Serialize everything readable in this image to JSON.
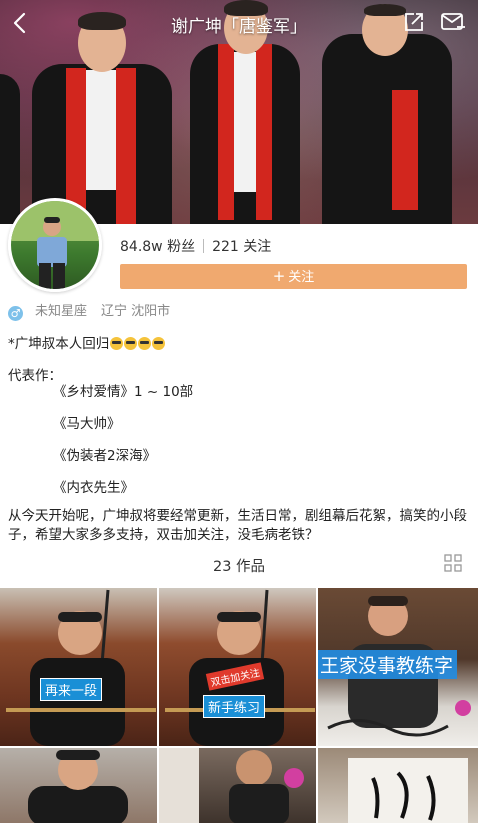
{
  "header": {
    "title": "谢广坤「唐鉴军」"
  },
  "profile": {
    "followers": "84.8w 粉丝",
    "following": "221 关注",
    "follow_label": "关注",
    "zodiac": "未知星座",
    "location": "辽宁 沈阳市"
  },
  "bio": {
    "line1": "*广坤叔本人回归",
    "intro_label": "代表作：",
    "works": [
      "《乡村爱情》1 ~ 10部",
      "《马大帅》",
      "《伪装者2深海》",
      "《内衣先生》"
    ],
    "paragraph": "从今天开始呢，广坤叔将要经常更新，生活日常，剧组幕后花絮，搞笑的小段子，希望大家多多支持，双击加关注，没毛病老铁？"
  },
  "works_section": {
    "count_label": "23 作品"
  },
  "thumbnails": [
    {
      "caption": "再来一段"
    },
    {
      "caption": "新手练习",
      "tag": "双击加关注"
    },
    {
      "caption": "王家没事教练字"
    },
    {
      "caption": ""
    },
    {
      "caption": ""
    },
    {
      "caption": ""
    }
  ],
  "icons": {
    "back": "back-chevron-icon",
    "share": "share-icon",
    "mail": "mail-icon",
    "gender": "male-icon",
    "grid": "grid-icon"
  },
  "colors": {
    "follow_button": "#f0a96f",
    "gender_badge": "#7ec1ea",
    "caption_blue": "#1a8fd6",
    "scarf_red": "#d2261e"
  }
}
